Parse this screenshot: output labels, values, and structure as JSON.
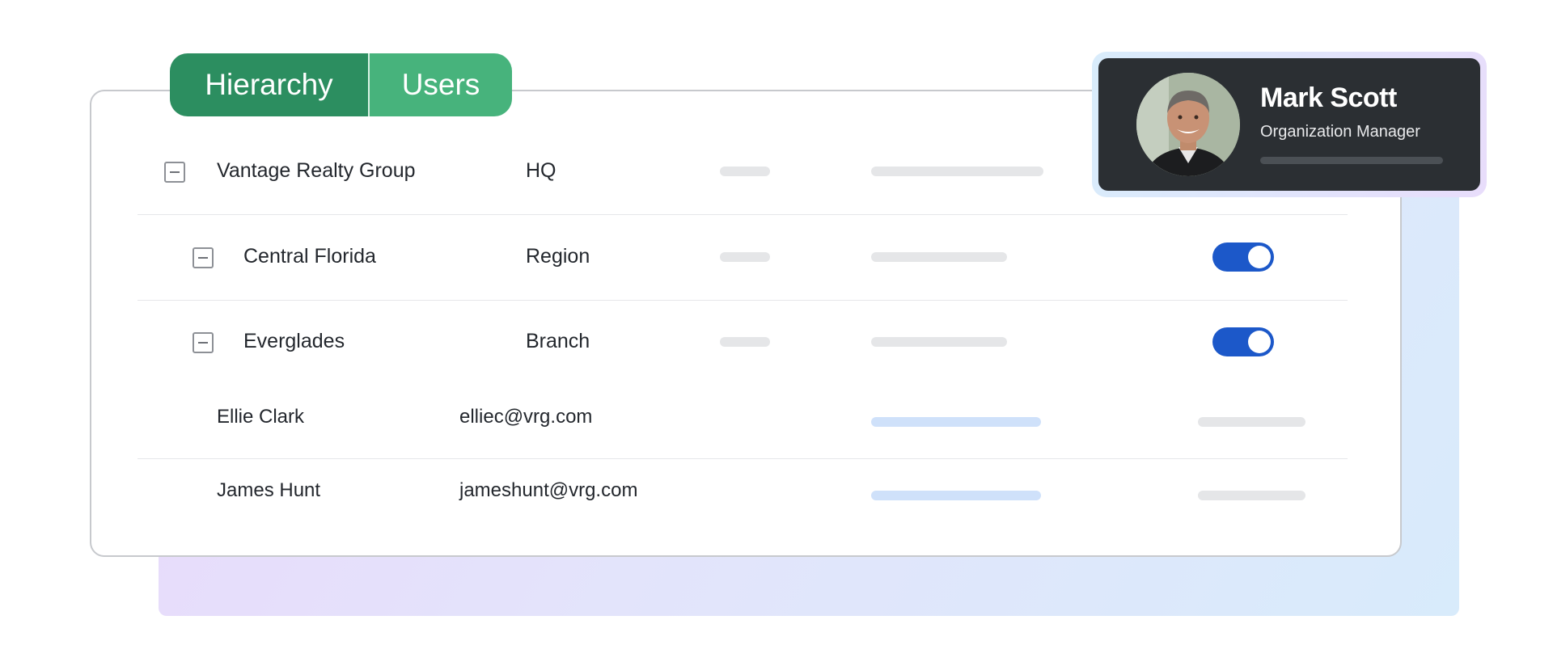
{
  "tabs": [
    {
      "label": "Hierarchy",
      "active": true
    },
    {
      "label": "Users",
      "active": false
    }
  ],
  "hierarchy": [
    {
      "name": "Vantage Realty Group",
      "type": "HQ",
      "toggle": null
    },
    {
      "name": "Central Florida",
      "type": "Region",
      "toggle": true
    },
    {
      "name": "Everglades",
      "type": "Branch",
      "toggle": true
    }
  ],
  "users": [
    {
      "name": "Ellie Clark",
      "email": "elliec@vrg.com"
    },
    {
      "name": "James Hunt",
      "email": "jameshunt@vrg.com"
    }
  ],
  "profile": {
    "name": "Mark Scott",
    "role": "Organization Manager"
  },
  "colors": {
    "tab_active": "#2c8e60",
    "tab_inactive": "#47b37c",
    "toggle_on": "#1c58c9",
    "profile_bg": "#2b2f33"
  }
}
